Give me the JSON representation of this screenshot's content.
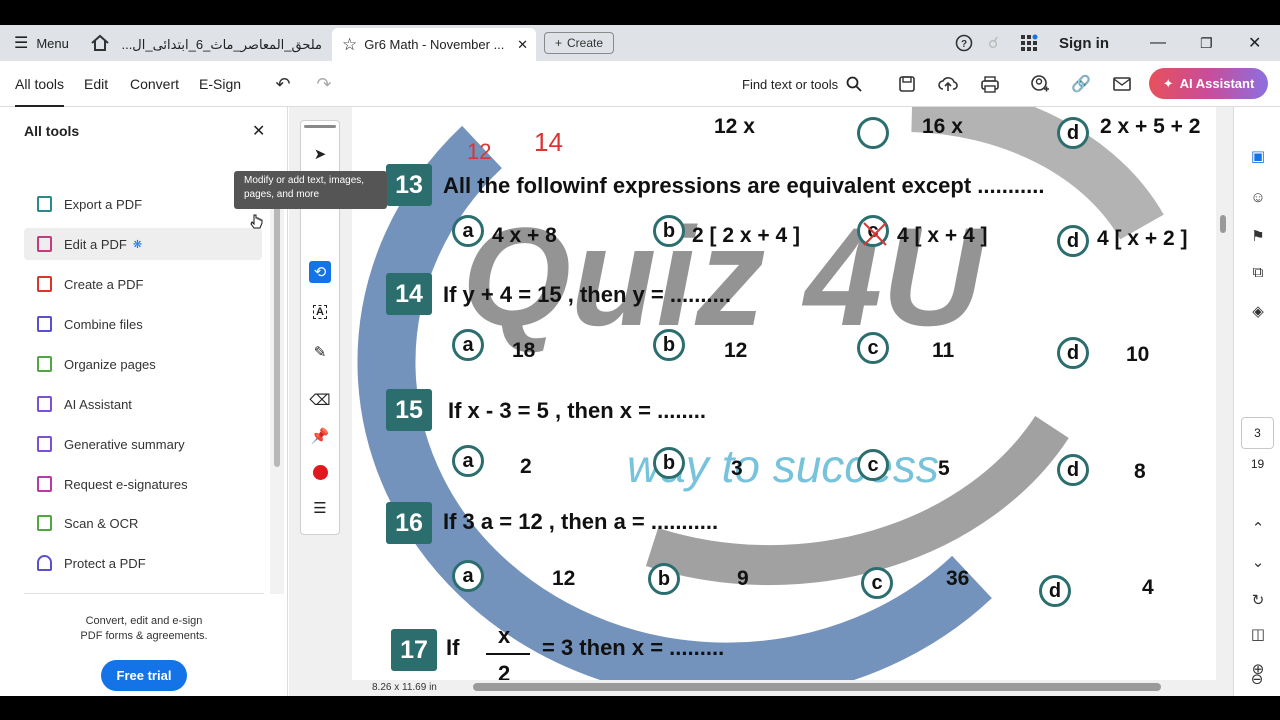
{
  "browser": {
    "menu_label": "Menu",
    "tab1_title": "ملحق_المعاصر_ماث_6_ابتدائى_ال...",
    "tab2_title": "Gr6 Math - November ...",
    "create_label": "Create",
    "signin_label": "Sign in"
  },
  "toolbar": {
    "tabs": [
      "All tools",
      "Edit",
      "Convert",
      "E-Sign"
    ],
    "find_label": "Find text or tools",
    "ai_label": "AI Assistant"
  },
  "left_panel": {
    "title": "All tools",
    "items": [
      "Export a PDF",
      "Edit a PDF",
      "Create a PDF",
      "Combine files",
      "Organize pages",
      "AI Assistant",
      "Generative summary",
      "Request e-signatures",
      "Scan & OCR",
      "Protect a PDF"
    ],
    "tooltip": "Modify or add text, images, pages, and more",
    "promo_line1": "Convert, edit and e-sign",
    "promo_line2": "PDF forms & agreements.",
    "trial_label": "Free trial"
  },
  "document": {
    "watermark": "Quiz 4U",
    "watermark_tagline": "way to success",
    "top_partial": [
      "12 x",
      "16 x",
      "2 x + 5 + 2"
    ],
    "questions": [
      {
        "num": "13",
        "text": "All the followinf expressions are equivalent except ...........",
        "options": [
          "4 x + 8",
          "2 [ 2 x + 4 ]",
          "4 [ x + 4 ]",
          "4 [ x + 2 ]"
        ]
      },
      {
        "num": "14",
        "text": "If y + 4 = 15 , then y = ..........",
        "options": [
          "18",
          "12",
          "11",
          "10"
        ]
      },
      {
        "num": "15",
        "text": "If x - 3 = 5 , then x = ........",
        "options": [
          "2",
          "3",
          "5",
          "8"
        ]
      },
      {
        "num": "16",
        "text": "If 3 a = 12 , then a = ...........",
        "options": [
          "12",
          "9",
          "36",
          "4"
        ]
      },
      {
        "num": "17",
        "text_if": "If",
        "frac_num": "x",
        "frac_den": "2",
        "text_rest": "=   3  then x = ........."
      }
    ],
    "option_letters": [
      "a",
      "b",
      "c",
      "d"
    ],
    "handwriting": [
      "12",
      "14"
    ],
    "page_size": "8.26 x 11.69 in"
  },
  "navigation": {
    "current_page": "3",
    "total_pages": "19"
  },
  "colors": {
    "accent_teal": "#2c6e6e",
    "primary_blue": "#1473e6",
    "watermark_gray": "#7a7a7a",
    "watermark_blue": "#4ab0d0"
  }
}
